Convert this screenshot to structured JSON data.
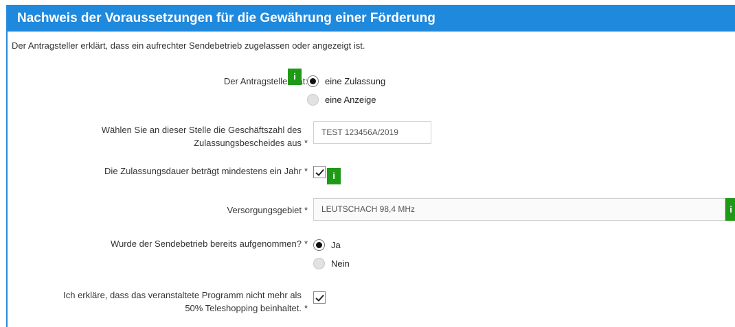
{
  "header": {
    "title": "Nachweis der Voraussetzungen für die Gewährung einer Förderung"
  },
  "intro": "Der Antragsteller erklärt, dass ein aufrechter Sendebetrieb zugelassen oder angezeigt ist.",
  "fields": {
    "antragsteller": {
      "label": "Der Antragsteller hat:",
      "options": [
        {
          "label": "eine Zulassung",
          "selected": true
        },
        {
          "label": "eine Anzeige",
          "selected": false
        }
      ]
    },
    "geschaeftszahl": {
      "label_line1": "Wählen Sie an dieser Stelle die Geschäftszahl des",
      "label_line2": "Zulassungsbescheides aus",
      "required": "*",
      "value": "TEST 123456A/2019"
    },
    "zulassungsdauer": {
      "label": "Die Zulassungsdauer beträgt mindestens ein Jahr",
      "required": "*",
      "checked": true
    },
    "versorgungsgebiet": {
      "label": "Versorgungsgebiet",
      "required": "*",
      "value": "LEUTSCHACH 98,4 MHz"
    },
    "sendebetrieb": {
      "label": "Wurde der Sendebetrieb bereits aufgenommen?",
      "required": "*",
      "options": [
        {
          "label": "Ja",
          "selected": true
        },
        {
          "label": "Nein",
          "selected": false
        }
      ]
    },
    "teleshopping": {
      "label_line1": "Ich erkläre, dass das veranstaltete Programm nicht mehr als",
      "label_line2": "50% Teleshopping beinhaltet.",
      "required": "*",
      "checked": true
    }
  },
  "info_label": "i",
  "colors": {
    "header": "#1f89dd",
    "info": "#1f9a17"
  }
}
